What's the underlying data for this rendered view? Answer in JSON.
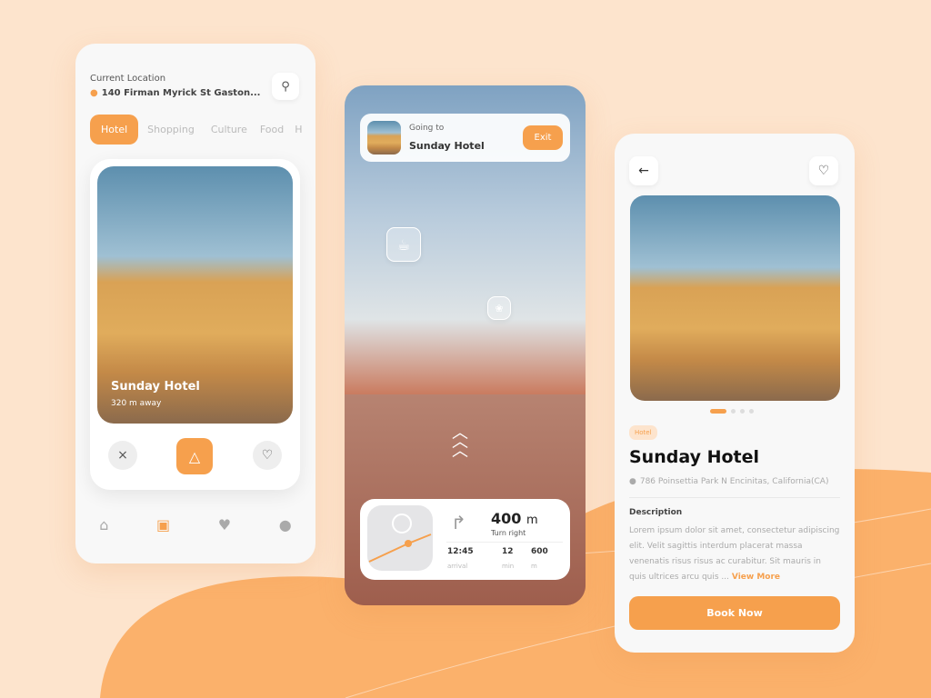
{
  "colors": {
    "accent": "#f6a04d",
    "background": "#fde4cd"
  },
  "home": {
    "location_label": "Current Location",
    "address": "140 Firman Myrick St Gaston...",
    "tabs": [
      {
        "label": "Hotel",
        "active": true
      },
      {
        "label": "Shopping"
      },
      {
        "label": "Culture"
      },
      {
        "label": "Food"
      },
      {
        "label": "H"
      }
    ],
    "card": {
      "title": "Sunday Hotel",
      "distance": "320 m away"
    },
    "actions": {
      "dismiss": "×"
    }
  },
  "nav": {
    "going_to": "Going to",
    "destination": "Sunday Hotel",
    "exit": "Exit",
    "distance": "400",
    "distance_unit": "m",
    "instruction": "Turn right",
    "stats": [
      {
        "value": "12:45",
        "label": "arrival"
      },
      {
        "value": "12",
        "label": "min"
      },
      {
        "value": "600",
        "label": "m"
      }
    ]
  },
  "detail": {
    "back": "←",
    "badge": "Hotel",
    "title": "Sunday Hotel",
    "address": "786 Poinsettia Park N Encinitas, California(CA)",
    "description_heading": "Description",
    "description": "Lorem ipsum dolor sit amet, consectetur adipiscing elit. Velit sagittis interdum placerat massa venenatis risus risus ac curabitur. Sit mauris in quis ultrices arcu quis ... ",
    "view_more": "View More",
    "book": "Book Now",
    "carousel": {
      "count": 4,
      "active": 1
    }
  }
}
